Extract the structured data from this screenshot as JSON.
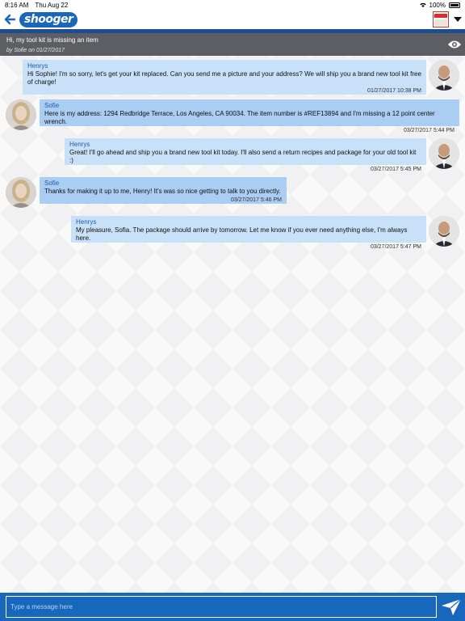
{
  "status_bar": {
    "time": "8:16 AM",
    "date": "Thu Aug 22",
    "battery": "100%"
  },
  "nav": {
    "logo_text": "shooger",
    "back_icon": "back-arrow-icon",
    "dropdown_icon": "chevron-down-icon"
  },
  "thread": {
    "title": "Hi, my tool kit is missing an item",
    "meta": "by Sofie  on 01/27/2017"
  },
  "messages": [
    {
      "sender": "Henrys",
      "text": "Hi Sophie! I'm so sorry, let's get your kit replaced. Can you send me a picture and your address? We will ship you a brand new tool kit free of charge!",
      "time": "01/27/2017 10:38 PM",
      "side": "right"
    },
    {
      "sender": "Sofie",
      "text": "Here is my address: 1294 Redbridge Terrace, Los Angeles, CA 90034. The item number is #REF13894 and I'm missing a 12 point center wrench.",
      "time": "03/27/2017 5:44 PM",
      "side": "left"
    },
    {
      "sender": "Henrys",
      "text": "Great! I'll go ahead and ship you a brand new tool kit today. I'll also send a return recipes and package for your old tool kit :)",
      "time": "03/27/2017 5:45 PM",
      "side": "right"
    },
    {
      "sender": "Sofie",
      "text": "Thanks for making it up to me, Henry! It's was so nice getting to talk to you directly.",
      "time": "03/27/2017 5:46 PM",
      "side": "left"
    },
    {
      "sender": "Henrys",
      "text": "My pleasure, Sofia. The package should arrive by tomorrow. Let me know if you ever need anything else, I'm always here.",
      "time": "03/27/2017 5:47 PM",
      "side": "right"
    }
  ],
  "composer": {
    "placeholder": "Type a message here"
  },
  "colors": {
    "brand_blue": "#1767bd",
    "header_gray": "#5c5e63",
    "agent_bubble": "#c9e1f8",
    "customer_bubble": "#a9cdf3"
  }
}
